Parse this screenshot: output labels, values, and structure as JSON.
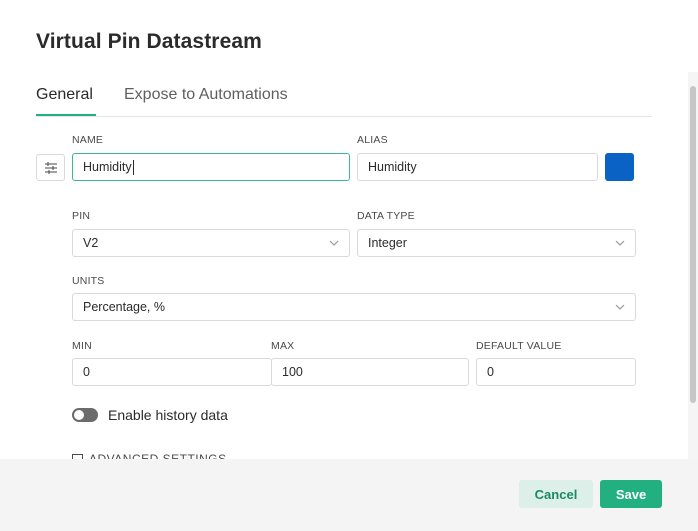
{
  "dialog": {
    "title": "Virtual Pin Datastream"
  },
  "tabs": [
    {
      "label": "General",
      "active": true
    },
    {
      "label": "Expose to Automations",
      "active": false
    }
  ],
  "form": {
    "name": {
      "label": "NAME",
      "value": "Humidity"
    },
    "alias": {
      "label": "ALIAS",
      "value": "Humidity"
    },
    "color": "#0a63c4",
    "pin": {
      "label": "PIN",
      "value": "V2"
    },
    "data_type": {
      "label": "DATA TYPE",
      "value": "Integer"
    },
    "units": {
      "label": "UNITS",
      "value": "Percentage, %"
    },
    "min": {
      "label": "MIN",
      "value": "0"
    },
    "max": {
      "label": "MAX",
      "value": "100"
    },
    "default_value": {
      "label": "DEFAULT VALUE",
      "value": "0"
    },
    "history": {
      "label": "Enable history data",
      "enabled": false
    },
    "advanced": {
      "label": "ADVANCED SETTINGS"
    }
  },
  "footer": {
    "cancel_label": "Cancel",
    "save_label": "Save"
  },
  "colors": {
    "accent": "#23b080",
    "cancel_bg": "#dcefe8"
  }
}
